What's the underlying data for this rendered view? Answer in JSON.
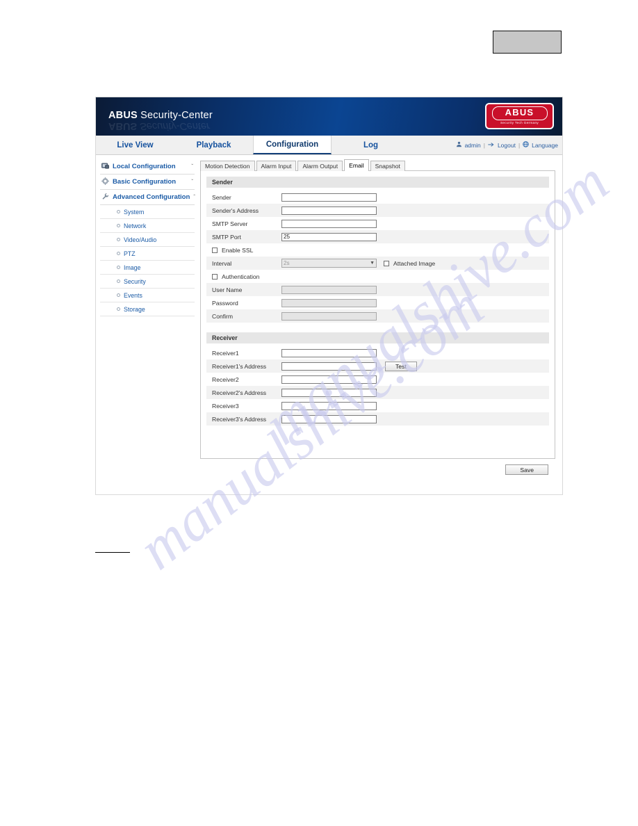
{
  "top_box": {
    "label": ""
  },
  "app": {
    "banner": {
      "brand_bold": "ABUS",
      "brand_rest": " Security-Center",
      "logo_text": "ABUS",
      "logo_tagline": "Security Tech Germany"
    },
    "nav": {
      "items": [
        {
          "label": "Live View",
          "active": false
        },
        {
          "label": "Playback",
          "active": false
        },
        {
          "label": "Configuration",
          "active": true
        },
        {
          "label": "Log",
          "active": false
        }
      ],
      "user": {
        "user_icon": "user-icon",
        "user_name": "admin",
        "separator": "|",
        "logout_icon": "logout-arrow-icon",
        "logout_label": "Logout",
        "language_icon": "globe-icon",
        "language_label": "Language"
      }
    },
    "sidebar": {
      "groups": [
        {
          "icon": "monitor-icon",
          "label": "Local Configuration",
          "chevron": "ˇ",
          "expanded": false
        },
        {
          "icon": "gear-icon",
          "label": "Basic Configuration",
          "chevron": "ˇ",
          "expanded": false
        },
        {
          "icon": "wrench-icon",
          "label": "Advanced Configuration",
          "chevron": "ˆ",
          "expanded": true
        }
      ],
      "advanced_items": [
        {
          "label": "System"
        },
        {
          "label": "Network"
        },
        {
          "label": "Video/Audio"
        },
        {
          "label": "PTZ"
        },
        {
          "label": "Image"
        },
        {
          "label": "Security"
        },
        {
          "label": "Events"
        },
        {
          "label": "Storage"
        }
      ]
    },
    "tabs": [
      {
        "label": "Motion Detection",
        "active": false
      },
      {
        "label": "Alarm Input",
        "active": false
      },
      {
        "label": "Alarm Output",
        "active": false
      },
      {
        "label": "Email",
        "active": true
      },
      {
        "label": "Snapshot",
        "active": false
      }
    ],
    "email_form": {
      "sender_section_title": "Sender",
      "fields": {
        "sender_label": "Sender",
        "sender_value": "",
        "sender_address_label": "Sender's Address",
        "sender_address_value": "",
        "smtp_server_label": "SMTP Server",
        "smtp_server_value": "",
        "smtp_port_label": "SMTP Port",
        "smtp_port_value": "25",
        "enable_ssl_label": "Enable SSL",
        "enable_ssl_checked": false,
        "interval_label": "Interval",
        "interval_value": "2s",
        "attached_image_label": "Attached Image",
        "attached_image_checked": false,
        "authentication_label": "Authentication",
        "authentication_checked": false,
        "user_name_label": "User Name",
        "user_name_value": "",
        "password_label": "Password",
        "password_value": "",
        "confirm_label": "Confirm",
        "confirm_value": ""
      },
      "receiver_section_title": "Receiver",
      "receiver": {
        "receiver1_label": "Receiver1",
        "receiver1_value": "",
        "receiver1_address_label": "Receiver1's Address",
        "receiver1_address_value": "",
        "test_button": "Test",
        "receiver2_label": "Receiver2",
        "receiver2_value": "",
        "receiver2_address_label": "Receiver2's Address",
        "receiver2_address_value": "",
        "receiver3_label": "Receiver3",
        "receiver3_value": "",
        "receiver3_address_label": "Receiver3's Address",
        "receiver3_address_value": ""
      },
      "save_button": "Save"
    }
  },
  "watermark": {
    "text": "manualshive.com"
  }
}
